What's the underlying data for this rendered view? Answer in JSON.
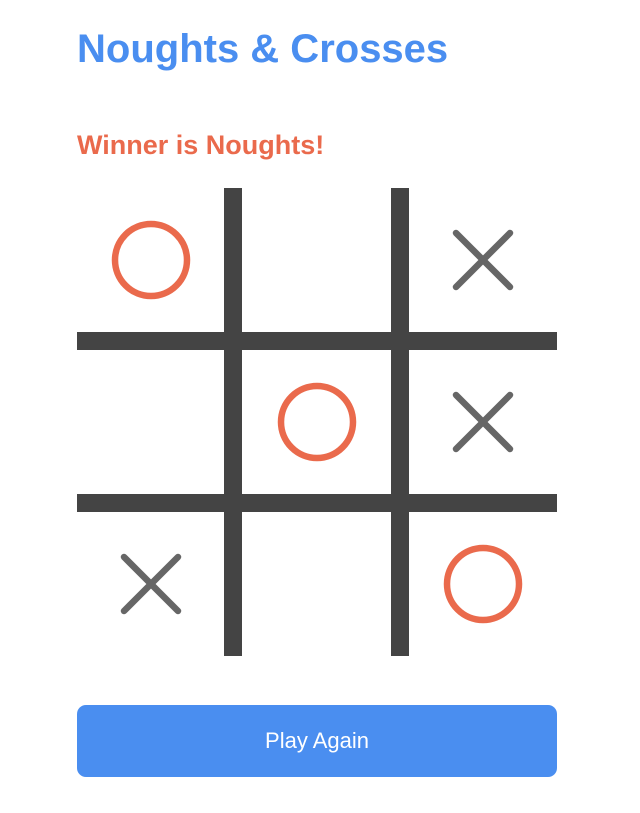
{
  "header": {
    "title": "Noughts & Crosses"
  },
  "status": {
    "text": "Winner is Noughts!"
  },
  "board": {
    "cells": [
      "O",
      "",
      "X",
      "",
      "O",
      "X",
      "X",
      "",
      "O"
    ]
  },
  "controls": {
    "play_again_label": "Play Again"
  },
  "colors": {
    "title": "#4a8ef0",
    "nought": "#ea6a4c",
    "cross": "#666666",
    "grid": "#444444",
    "button_bg": "#4a8ef0",
    "button_text": "#ffffff"
  },
  "icons": {
    "nought": "nought-icon",
    "cross": "cross-icon"
  }
}
